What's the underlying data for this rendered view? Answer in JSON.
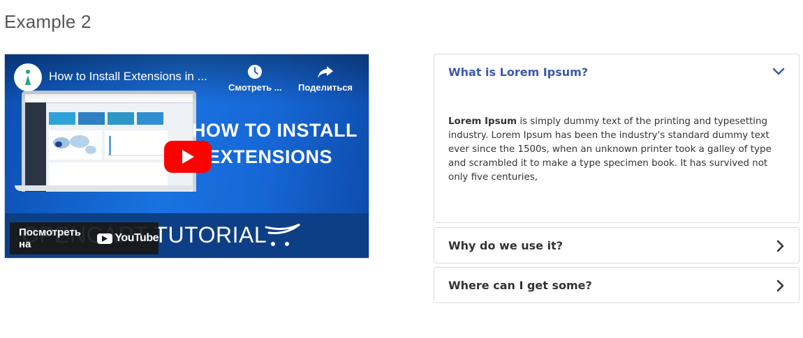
{
  "page": {
    "heading": "Example 2"
  },
  "video": {
    "title": "How to Install Extensions in ...",
    "watch_later_label": "Смотреть ...",
    "share_label": "Поделиться",
    "overlay_lines": [
      "HOW TO INSTALL",
      "EXTENSIONS"
    ],
    "bottom_text": "OPENCART TUTORIAL",
    "watch_on_label": "Посмотреть на",
    "youtube_label": "YouTube",
    "colors": {
      "play": "#ff0000",
      "background": "#1a6fd6"
    }
  },
  "accordion": {
    "items": [
      {
        "title": "What is Lorem Ipsum?",
        "expanded": true,
        "body_strong": "Lorem Ipsum",
        "body_text": " is simply dummy text of the printing and typesetting industry. Lorem Ipsum has been the industry's standard dummy text ever since the 1500s, when an unknown printer took a galley of type and scrambled it to make a type specimen book. It has survived not only five centuries,",
        "icon": "chevron-down-icon"
      },
      {
        "title": "Why do we use it?",
        "expanded": false,
        "icon": "chevron-right-icon"
      },
      {
        "title": "Where can I get some?",
        "expanded": false,
        "icon": "chevron-right-icon"
      }
    ],
    "colors": {
      "active_title": "#3d5aa8",
      "title": "#333333"
    }
  }
}
